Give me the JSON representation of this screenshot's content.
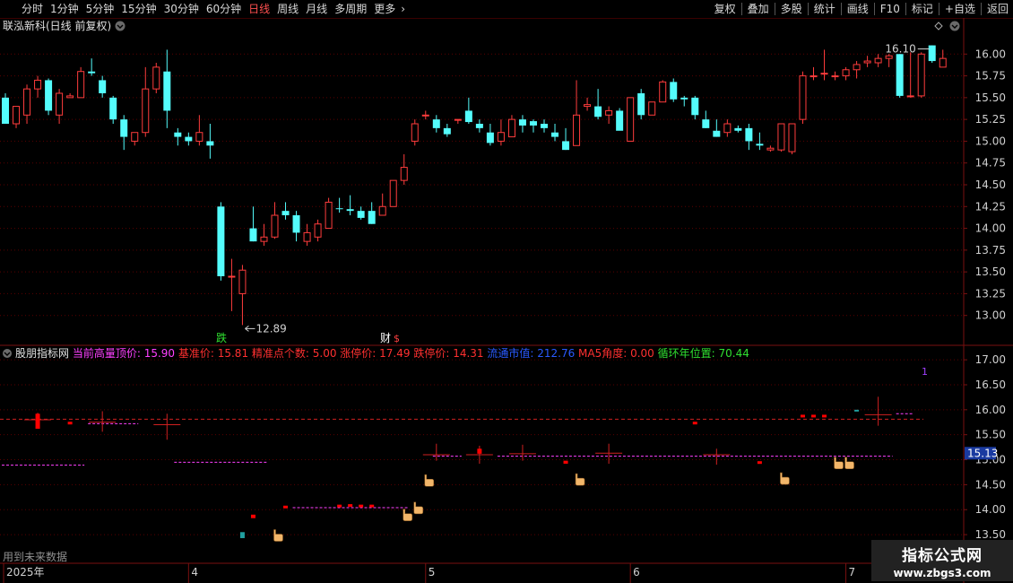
{
  "toolbar": {
    "periods": [
      "分时",
      "1分钟",
      "5分钟",
      "15分钟",
      "30分钟",
      "60分钟",
      "日线",
      "周线",
      "月线",
      "多周期",
      "更多"
    ],
    "active_period": "日线",
    "tools": [
      "复权",
      "叠加",
      "多股",
      "统计",
      "画线",
      "F10",
      "标记",
      "+自选",
      "返回"
    ]
  },
  "colors": {
    "up": "#ff3c3c",
    "down": "#54fcfc",
    "grid": "#5a0000",
    "axis": "#7a1010",
    "magenta": "#ff40ff",
    "marker_red": "#ff0000",
    "finger": "#f2b66a"
  },
  "chart_data": [
    {
      "type": "candlestick",
      "title": "联泓新科(日线 前复权)",
      "ylim": [
        12.75,
        16.25
      ],
      "yticks": [
        "16.00",
        "15.75",
        "15.50",
        "15.25",
        "15.00",
        "14.75",
        "14.50",
        "14.25",
        "14.00",
        "13.75",
        "13.50",
        "13.25",
        "13.00"
      ],
      "annotations": {
        "high_label": "16.10",
        "low_label": "12.89",
        "event_die": "跌",
        "event_cai": "财",
        "event_dollar": "$"
      },
      "candles": [
        [
          15.5,
          15.55,
          15.2,
          15.2
        ],
        [
          15.2,
          15.4,
          15.15,
          15.4
        ],
        [
          15.3,
          15.65,
          15.2,
          15.6
        ],
        [
          15.6,
          15.75,
          15.5,
          15.7
        ],
        [
          15.7,
          15.72,
          15.3,
          15.35
        ],
        [
          15.3,
          15.6,
          15.2,
          15.55
        ],
        [
          15.5,
          15.55,
          15.5,
          15.52
        ],
        [
          15.5,
          15.85,
          15.5,
          15.8
        ],
        [
          15.8,
          15.95,
          15.75,
          15.78
        ],
        [
          15.7,
          15.75,
          15.5,
          15.55
        ],
        [
          15.5,
          15.52,
          15.2,
          15.25
        ],
        [
          15.25,
          15.3,
          14.9,
          15.05
        ],
        [
          15.0,
          15.1,
          14.95,
          15.1
        ],
        [
          15.1,
          15.85,
          15.05,
          15.6
        ],
        [
          15.6,
          15.9,
          15.55,
          15.85
        ],
        [
          15.8,
          16.05,
          15.15,
          15.35
        ],
        [
          15.1,
          15.15,
          14.95,
          15.05
        ],
        [
          15.05,
          15.1,
          14.95,
          15.0
        ],
        [
          15.0,
          15.3,
          14.95,
          15.1
        ],
        [
          15.0,
          15.2,
          14.8,
          14.95
        ],
        [
          14.25,
          14.3,
          13.4,
          13.45
        ],
        [
          13.45,
          13.65,
          13.05,
          13.45
        ],
        [
          13.25,
          13.58,
          12.89,
          13.52
        ],
        [
          14.0,
          14.25,
          13.85,
          13.85
        ],
        [
          13.85,
          14.05,
          13.8,
          13.9
        ],
        [
          13.9,
          14.3,
          13.88,
          14.15
        ],
        [
          14.2,
          14.3,
          14.1,
          14.15
        ],
        [
          14.15,
          14.2,
          13.85,
          13.95
        ],
        [
          13.85,
          14.05,
          13.8,
          13.95
        ],
        [
          13.9,
          14.1,
          13.85,
          14.05
        ],
        [
          14.0,
          14.35,
          14.0,
          14.3
        ],
        [
          14.23,
          14.35,
          14.18,
          14.22
        ],
        [
          14.22,
          14.38,
          14.15,
          14.2
        ],
        [
          14.2,
          14.25,
          14.1,
          14.12
        ],
        [
          14.2,
          14.3,
          14.05,
          14.05
        ],
        [
          14.15,
          14.4,
          14.15,
          14.25
        ],
        [
          14.25,
          14.55,
          14.25,
          14.55
        ],
        [
          14.55,
          14.85,
          14.5,
          14.7
        ],
        [
          15.0,
          15.25,
          14.95,
          15.2
        ],
        [
          15.3,
          15.35,
          15.25,
          15.3
        ],
        [
          15.25,
          15.3,
          15.1,
          15.15
        ],
        [
          15.15,
          15.2,
          15.05,
          15.08
        ],
        [
          15.25,
          15.25,
          15.2,
          15.25
        ],
        [
          15.35,
          15.5,
          15.2,
          15.22
        ],
        [
          15.2,
          15.25,
          15.1,
          15.15
        ],
        [
          15.1,
          15.2,
          14.95,
          14.98
        ],
        [
          15.0,
          15.25,
          14.95,
          15.1
        ],
        [
          15.05,
          15.3,
          15.05,
          15.25
        ],
        [
          15.25,
          15.3,
          15.1,
          15.18
        ],
        [
          15.23,
          15.25,
          15.1,
          15.18
        ],
        [
          15.2,
          15.25,
          15.1,
          15.15
        ],
        [
          15.1,
          15.2,
          15.0,
          15.05
        ],
        [
          15.0,
          15.15,
          14.9,
          14.9
        ],
        [
          14.95,
          15.7,
          14.95,
          15.3
        ],
        [
          15.4,
          15.5,
          15.35,
          15.42
        ],
        [
          15.4,
          15.6,
          15.25,
          15.28
        ],
        [
          15.3,
          15.4,
          15.2,
          15.35
        ],
        [
          15.35,
          15.38,
          15.15,
          15.12
        ],
        [
          15.0,
          15.5,
          15.0,
          15.5
        ],
        [
          15.55,
          15.6,
          15.25,
          15.3
        ],
        [
          15.3,
          15.45,
          15.3,
          15.45
        ],
        [
          15.45,
          15.7,
          15.45,
          15.68
        ],
        [
          15.68,
          15.72,
          15.45,
          15.48
        ],
        [
          15.5,
          15.52,
          15.4,
          15.48
        ],
        [
          15.5,
          15.52,
          15.25,
          15.3
        ],
        [
          15.25,
          15.35,
          15.15,
          15.15
        ],
        [
          15.12,
          15.25,
          15.05,
          15.05
        ],
        [
          15.1,
          15.25,
          15.05,
          15.2
        ],
        [
          15.15,
          15.18,
          15.1,
          15.12
        ],
        [
          15.15,
          15.2,
          14.9,
          15.0
        ],
        [
          14.97,
          15.1,
          14.9,
          14.95
        ],
        [
          14.9,
          14.95,
          14.88,
          14.92
        ],
        [
          14.9,
          15.2,
          14.88,
          15.2
        ],
        [
          14.88,
          15.2,
          14.85,
          15.2
        ],
        [
          15.25,
          15.8,
          15.2,
          15.75
        ],
        [
          15.75,
          15.85,
          15.7,
          15.75
        ],
        [
          15.78,
          16.05,
          15.7,
          15.78
        ],
        [
          15.75,
          15.8,
          15.7,
          15.75
        ],
        [
          15.75,
          15.85,
          15.7,
          15.82
        ],
        [
          15.82,
          15.92,
          15.72,
          15.88
        ],
        [
          15.9,
          15.98,
          15.85,
          15.92
        ],
        [
          15.9,
          16.0,
          15.85,
          15.95
        ],
        [
          15.95,
          16.0,
          15.85,
          15.98
        ],
        [
          16.0,
          16.0,
          15.5,
          15.52
        ],
        [
          15.52,
          16.02,
          15.5,
          15.52
        ],
        [
          15.52,
          16.02,
          15.5,
          16.0
        ],
        [
          16.1,
          16.1,
          15.9,
          15.92
        ],
        [
          15.85,
          16.05,
          15.85,
          15.95
        ]
      ]
    },
    {
      "type": "indicator",
      "title": "股朋指标网",
      "legend": [
        {
          "label": "当前高量顶价:",
          "value": "15.90",
          "color": "#ff40ff"
        },
        {
          "label": "基准价:",
          "value": "15.81",
          "color": "#ff3030"
        },
        {
          "label": "精准点个数:",
          "value": "5.00",
          "color": "#ff3030"
        },
        {
          "label": "涨停价:",
          "value": "17.49",
          "color": "#ff3030"
        },
        {
          "label": "跌停价:",
          "value": "14.31",
          "color": "#ff3030"
        },
        {
          "label": "流通市值:",
          "value": "212.76",
          "color": "#2a5aff"
        },
        {
          "label": "MA5角度:",
          "value": "0.00",
          "color": "#ff3030"
        },
        {
          "label": "循环年位置:",
          "value": "70.44",
          "color": "#30e030"
        }
      ],
      "ylim": [
        13.25,
        17.2
      ],
      "yticks": [
        "17.00",
        "16.50",
        "16.00",
        "15.50",
        "15.00",
        "14.50",
        "14.00",
        "13.50"
      ],
      "reference_line": 15.81,
      "current_price_label": "15.13",
      "corner_mark": "1",
      "bottom_note": "用到未来数据",
      "crosses": [
        [
          3,
          15.8,
          15.94,
          15.62
        ],
        [
          9,
          15.75,
          15.97,
          15.56
        ],
        [
          15,
          15.7,
          15.92,
          15.4
        ],
        [
          40,
          15.1,
          15.32,
          14.98
        ],
        [
          44,
          15.1,
          15.28,
          14.92
        ],
        [
          48,
          15.12,
          15.3,
          14.98
        ],
        [
          56,
          15.13,
          15.32,
          14.92
        ],
        [
          66,
          15.1,
          15.22,
          14.9
        ],
        [
          81,
          15.9,
          16.26,
          15.68
        ]
      ],
      "red_marks": [
        [
          3,
          15.92,
          15.62
        ],
        [
          6,
          15.76,
          15.74
        ],
        [
          23,
          13.9,
          13.83
        ],
        [
          26,
          14.08,
          14.03
        ],
        [
          31,
          14.1,
          14.08
        ],
        [
          32,
          14.11,
          14.09
        ],
        [
          33,
          14.1,
          14.08
        ],
        [
          34,
          14.1,
          14.05
        ],
        [
          44,
          15.22,
          15.12
        ],
        [
          52,
          14.98,
          14.92
        ],
        [
          64,
          15.76,
          15.74
        ],
        [
          70,
          14.97,
          14.95
        ],
        [
          74,
          15.9,
          15.88
        ],
        [
          75,
          15.9,
          15.88
        ],
        [
          76,
          15.9,
          15.85
        ]
      ],
      "teal_marks": [
        [
          22,
          13.55,
          13.43
        ],
        [
          79,
          16.0,
          15.98
        ]
      ],
      "dashed_segments": [
        [
          0,
          7,
          14.89
        ],
        [
          8,
          12,
          15.72
        ],
        [
          16,
          24,
          14.95
        ],
        [
          27,
          37,
          14.04
        ],
        [
          40,
          42,
          15.07
        ],
        [
          46,
          82,
          15.07
        ],
        [
          83,
          84,
          15.92
        ]
      ],
      "fingers": [
        [
          25,
          13.6
        ],
        [
          37,
          14.01
        ],
        [
          38,
          14.15
        ],
        [
          39,
          14.7
        ],
        [
          53,
          14.72
        ],
        [
          72,
          14.74
        ],
        [
          77,
          15.05
        ],
        [
          78,
          15.05
        ]
      ],
      "x_dates": [
        "2025年",
        "4",
        "5",
        "6",
        "7"
      ]
    }
  ]
}
